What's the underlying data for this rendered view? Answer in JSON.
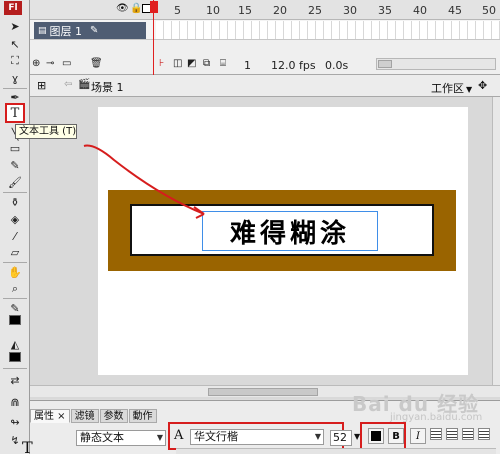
{
  "toolbar": {
    "logo": "Fl",
    "text_tool_glyph": "T",
    "tooltip": "文本工具 (T)"
  },
  "timeline": {
    "frame_numbers": [
      "5",
      "10",
      "15",
      "20",
      "25",
      "30",
      "35",
      "40",
      "45",
      "50"
    ],
    "layer_name": "图层 1",
    "current_frame": "1",
    "fps": "12.0 fps",
    "time": "0.0s"
  },
  "editbar": {
    "scene": "场景 1",
    "workspace": "工作区"
  },
  "stage": {
    "text": "难得糊涂"
  },
  "properties": {
    "tabs": [
      "属性",
      "滤镜",
      "参数",
      "動作"
    ],
    "text_type": "静态文本",
    "font_family": "华文行楷",
    "font_size": "52",
    "bold_label": "B",
    "italic_label": "I"
  },
  "watermark": {
    "brand": "Bai du 经验",
    "url": "jingyan.baidu.com"
  },
  "colors": {
    "frame_brown": "#9a6400",
    "highlight_red": "#d61d1d",
    "layer_selected": "#4f5d73"
  }
}
